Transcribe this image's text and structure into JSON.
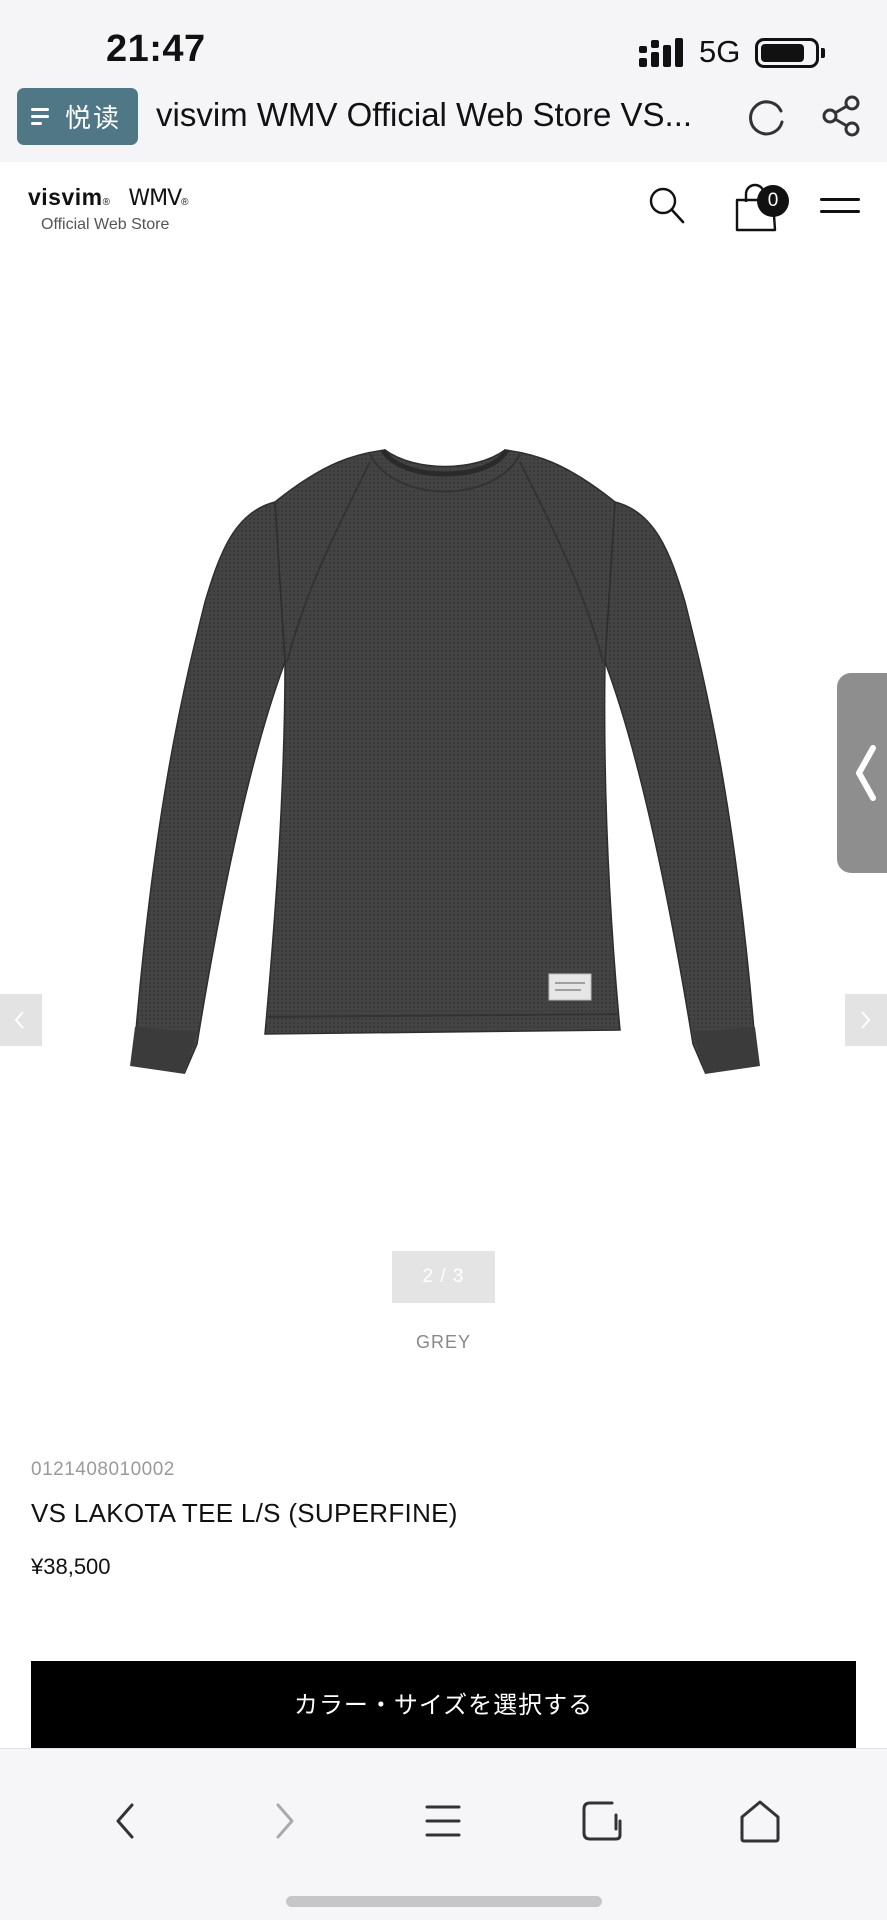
{
  "status_bar": {
    "time": "21:47",
    "network": "5G",
    "battery_level": 0.82
  },
  "browser": {
    "reader_label": "悦读",
    "tab_title": "visvim WMV Official Web Store VS...",
    "icons": [
      "menu-icon",
      "refresh-icon",
      "share-icon"
    ]
  },
  "site_header": {
    "logo_visvim": "visvim",
    "logo_wmv": "WMV",
    "logo_subtitle": "Official Web Store",
    "cart_count": "0",
    "icons": [
      "search-icon",
      "shopping-bag-icon",
      "hamburger-menu-icon"
    ]
  },
  "gallery": {
    "pager": "2 / 3",
    "color_name": "GREY",
    "image_subject": "charcoal grey long-sleeve waffle knit tee",
    "image_color": "#3f3f3f"
  },
  "product": {
    "sku": "0121408010002",
    "name": "VS LAKOTA TEE L/S (SUPERFINE)",
    "price": "¥38,500",
    "select_button": "カラー・サイズを選択する"
  },
  "bottom_nav": {
    "icons": [
      "back-icon",
      "forward-icon",
      "menu-icon",
      "tabs-icon",
      "home-icon"
    ]
  },
  "colors": {
    "reader_accent": "#4f7785",
    "button_bg": "#000000",
    "side_tab": "#8e8e8e"
  }
}
